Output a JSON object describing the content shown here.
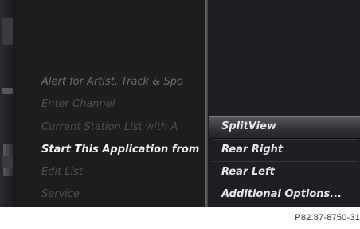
{
  "main_menu": {
    "items": [
      {
        "label": "Alert for Artist, Track & Spo"
      },
      {
        "label": "Enter Channel"
      },
      {
        "label": "Current Station List with A"
      },
      {
        "label": "Start This Application from"
      },
      {
        "label": "Edit List"
      },
      {
        "label": "Service"
      }
    ],
    "highlighted_index": 3
  },
  "submenu": {
    "items": [
      {
        "label": "SplitView"
      },
      {
        "label": "Rear Right"
      },
      {
        "label": "Rear Left"
      },
      {
        "label": "Additional Options..."
      }
    ],
    "selected_index": 0
  },
  "footer": {
    "image_code": "P82.87-8750-31"
  }
}
